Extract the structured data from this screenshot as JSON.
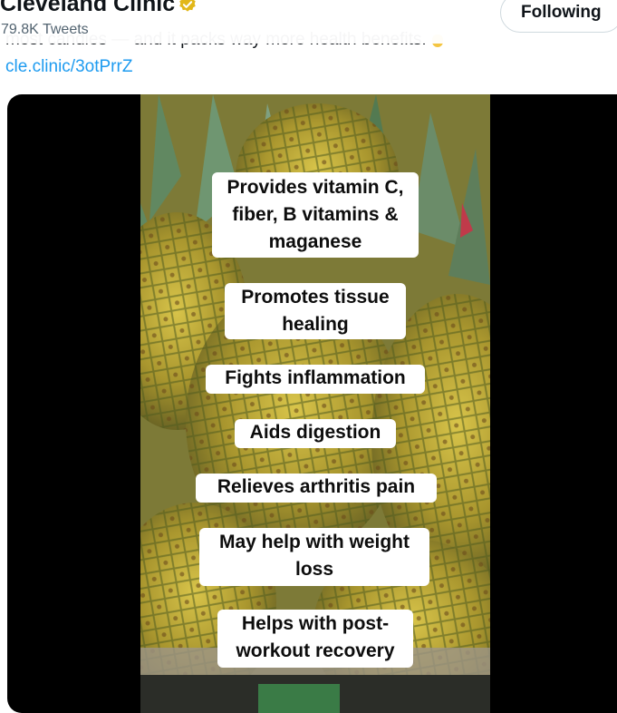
{
  "header": {
    "account_name": "Cleveland Clinic",
    "tweet_count": "79.8K Tweets",
    "follow_button": "Following"
  },
  "tweet": {
    "text": "most candies — and it packs way more health benefits.",
    "link": "cle.clinic/3otPrrZ"
  },
  "video": {
    "labels": [
      {
        "line1": "Provides vitamin C,",
        "line2": "fiber, B vitamins &",
        "line3": "maganese"
      },
      {
        "line1": "Promotes tissue",
        "line2": "healing"
      },
      {
        "line1": "Fights inflammation"
      },
      {
        "line1": "Aids digestion"
      },
      {
        "line1": "Relieves arthritis pain"
      },
      {
        "line1": "May help with weight",
        "line2": "loss"
      },
      {
        "line1": "Helps with post-",
        "line2": "workout recovery"
      }
    ]
  },
  "icons": {
    "verified": "verified-badge-icon"
  },
  "colors": {
    "link": "#1d9bf0",
    "badge": "#e2b719",
    "muted": "#536471"
  }
}
